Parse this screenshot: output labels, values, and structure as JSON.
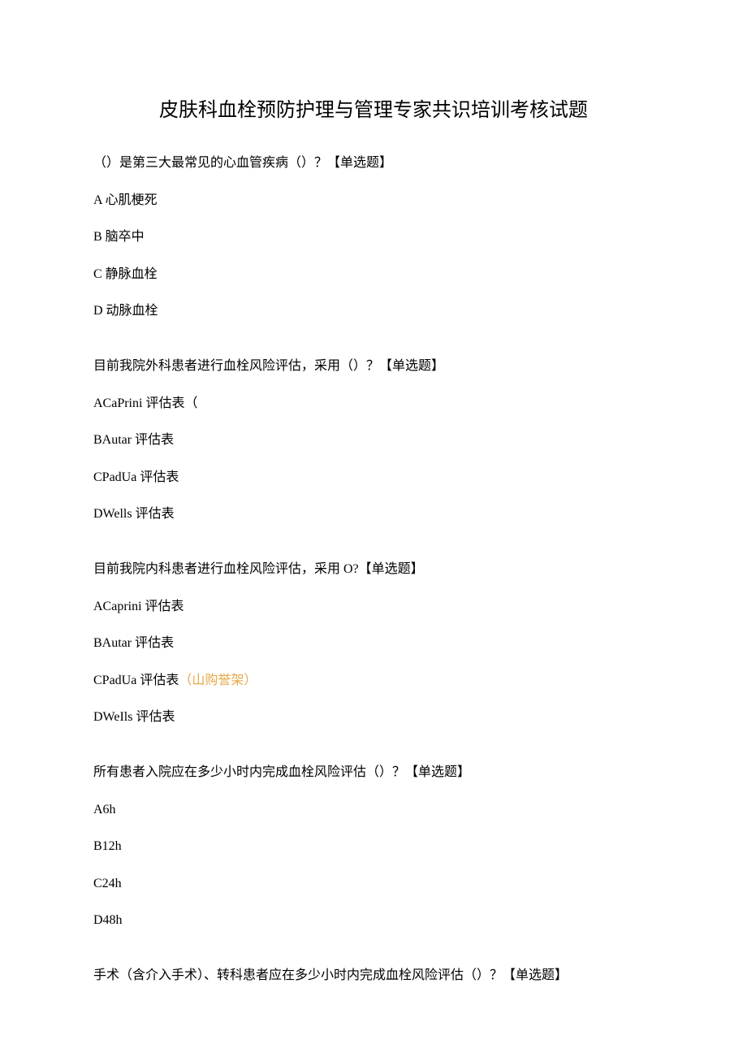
{
  "title": "皮肤科血栓预防护理与管理专家共识培训考核试题",
  "questions": [
    {
      "text": "（）是第三大最常见的心血管疾病（）？【单选题】",
      "options": [
        "A 心肌梗死",
        "B 脑卒中",
        "C 静脉血栓",
        "D 动脉血栓"
      ]
    },
    {
      "text": "目前我院外科患者进行血栓风险评估，采用（）？【单选题】",
      "options": [
        "ACaPrini 评估表（",
        "BAutar 评估表",
        "CPadUa 评估表",
        "DWells 评估表"
      ]
    },
    {
      "text": "目前我院内科患者进行血栓风险评估，采用 O?【单选题】",
      "options": [
        "ACaprini 评估表",
        "BAutar 评估表",
        "CPadUa 评估表",
        "DWeIls 评估表"
      ],
      "annotationIndex": 2,
      "annotation": "（山购誉架）"
    },
    {
      "text": "所有患者入院应在多少小时内完成血栓风险评估（）？【单选题】",
      "options": [
        "A6h",
        "B12h",
        "C24h",
        "D48h"
      ]
    }
  ],
  "finalQuestion": "手术（含介入手术）、转科患者应在多少小时内完成血栓风险评估（）？【单选题】"
}
